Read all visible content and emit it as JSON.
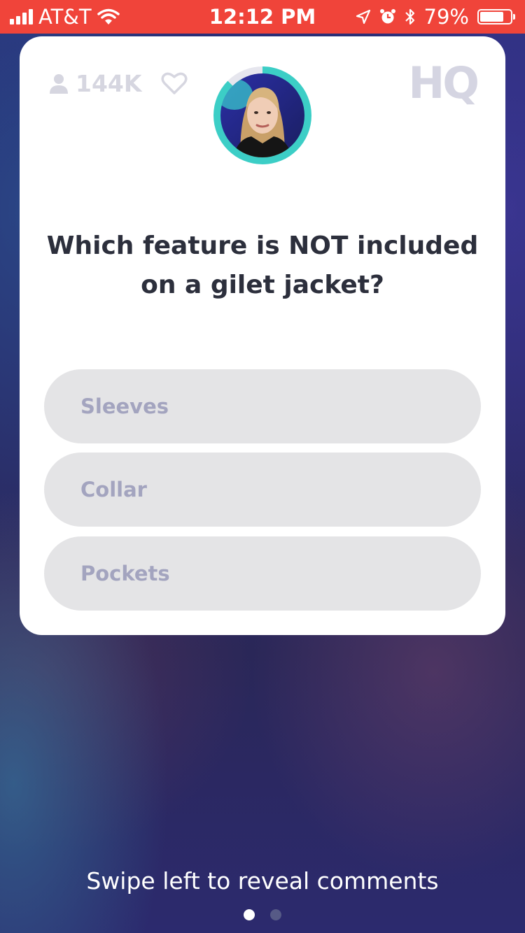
{
  "status_bar": {
    "carrier": "AT&T",
    "time": "12:12 PM",
    "battery_percent": "79%",
    "battery_level": 0.79,
    "icons": [
      "signal-icon",
      "wifi-icon",
      "location-icon",
      "alarm-icon",
      "bluetooth-icon",
      "battery-icon"
    ]
  },
  "game": {
    "viewer_count": "144K",
    "logo": "HQ",
    "timer_progress": 0.875,
    "question": "Which feature is NOT included on a gilet jacket?",
    "answers": [
      {
        "label": "Sleeves"
      },
      {
        "label": "Collar"
      },
      {
        "label": "Pockets"
      }
    ]
  },
  "footer": {
    "hint": "Swipe left to reveal comments",
    "page_count": 2,
    "active_page": 1
  },
  "colors": {
    "status_bar": "#f0443a",
    "timer_ring": "#3ccec6",
    "answer_bg": "#e4e4e6",
    "answer_text": "#a3a4bf",
    "question_text": "#2c2f3c"
  }
}
